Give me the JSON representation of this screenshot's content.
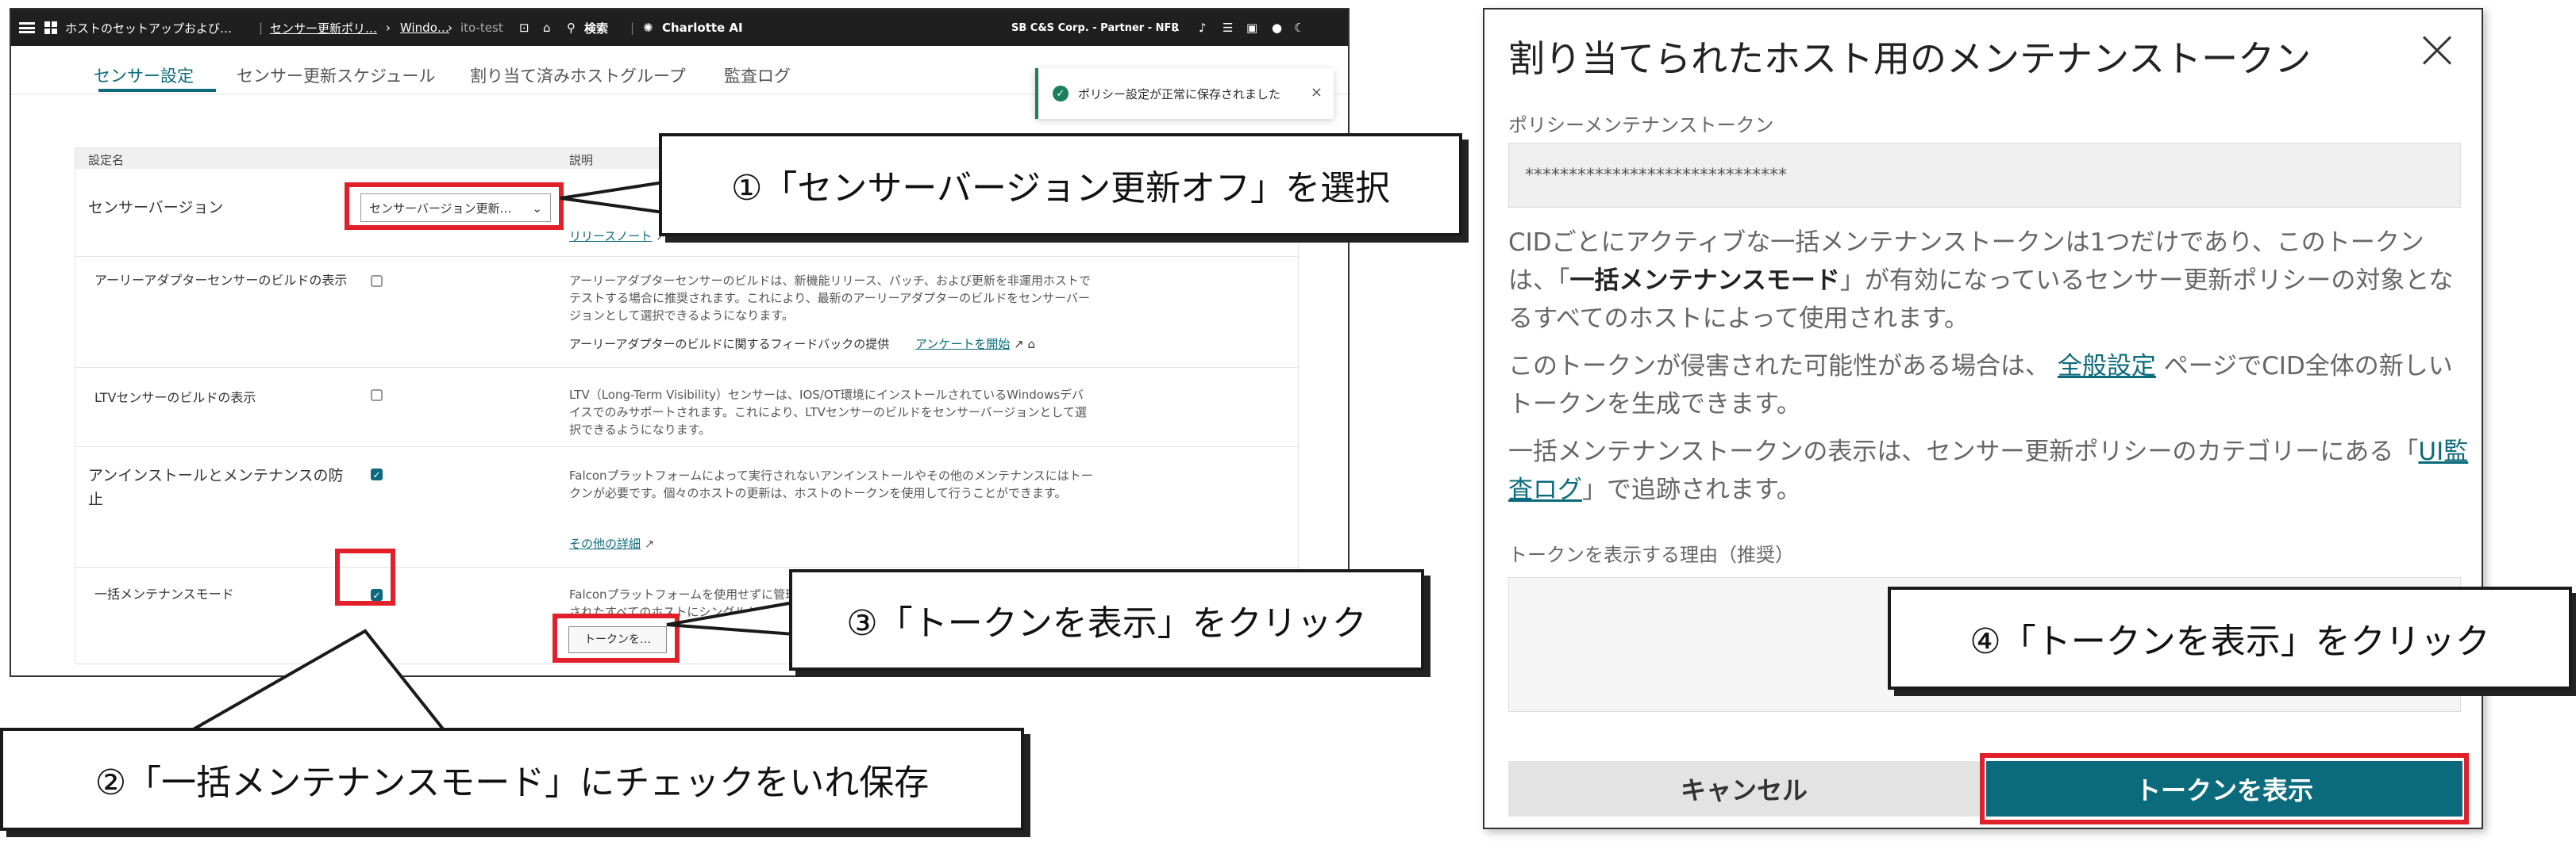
{
  "colors": {
    "accent": "#0b6b7c",
    "highlight_red": "#e2202a",
    "success": "#1a7f5a",
    "topbar": "#1f1f1f"
  },
  "topbar": {
    "breadcrumb_1": "ホストのセットアップおよび…",
    "breadcrumb_2": "センサー更新ポリ…",
    "breadcrumb_3": "Windo…",
    "breadcrumb_4": "ito-test",
    "search_label": "検索",
    "assistant_label": "Charlotte AI",
    "org_label": "SB C&S Corp. - Partner - NFR"
  },
  "tabs": [
    {
      "label": "センサー設定"
    },
    {
      "label": "センサー更新スケジュール"
    },
    {
      "label": "割り当て済みホストグループ"
    },
    {
      "label": "監査ログ"
    }
  ],
  "toast": {
    "message": "ポリシー設定が正常に保存されました",
    "close": "×"
  },
  "table": {
    "col_setting": "設定名",
    "col_desc": "説明",
    "rows": [
      {
        "name": "センサーバージョン",
        "select_value": "センサーバージョン更新…",
        "desc_link": "リリースノート"
      },
      {
        "name": "アーリーアダプターセンサーのビルドの表示",
        "desc": "アーリーアダプターセンサーのビルドは、新機能リリース、パッチ、および更新を非運用ホストでテストする場合に推奨されます。これにより、最新のアーリーアダプターのビルドをセンサーバージョンとして選択できるようになります。",
        "feedback": "アーリーアダプターのビルドに関するフィードバックの提供",
        "survey_link": "アンケートを開始"
      },
      {
        "name": "LTVセンサーのビルドの表示",
        "desc": "LTV（Long-Term Visibility）センサーは、IOS/OT環境にインストールされているWindowsデバイスでのみサポートされます。これにより、LTVセンサーのビルドをセンサーバージョンとして選択できるようになります。"
      },
      {
        "name": "アンインストールとメンテナンスの防止",
        "desc": "Falconプラットフォームによって実行されないアンインストールやその他のメンテナンスにはトークンが必要です。個々のホストの更新は、ホストのトークンを使用して行うことができます。",
        "more_link": "その他の詳細"
      },
      {
        "name": "一括メンテナンスモード",
        "desc": "Falconプラットフォームを使用せずに管理されたすべてのホストにシングルトークン",
        "button": "トークンを…"
      }
    ]
  },
  "callouts": {
    "c1": "①「センサーバージョン更新オフ」を選択",
    "c2": "②「一括メンテナンスモード」にチェックをいれ保存",
    "c3": "③「トークンを表示」をクリック",
    "c4": "④「トークンを表示」をクリック"
  },
  "dialog": {
    "title": "割り当てられたホスト用のメンテナンストークン",
    "token_label": "ポリシーメンテナンストークン",
    "token_value": "******************************",
    "p1_a": "CIDごとにアクティブな一括メンテナンストークンは1つだけであり、このトークンは、「",
    "p1_b": "一括メンテナンスモード",
    "p1_c": "」が有効になっているセンサー更新ポリシーの対象となるすべてのホストによって使用されます。",
    "p2_a": "このトークンが侵害された可能性がある場合は、",
    "p2_link": "全般設定",
    "p2_b": "ページでCID全体の新しいトークンを生成できます。",
    "p3_a": "一括メンテナンストークンの表示は、センサー更新ポリシーのカテゴリーにある「",
    "p3_link": "UI監査ログ",
    "p3_b": "」で追跡されます。",
    "reason_label": "トークンを表示する理由（推奨）",
    "cancel": "キャンセル",
    "show_token": "トークンを表示"
  }
}
